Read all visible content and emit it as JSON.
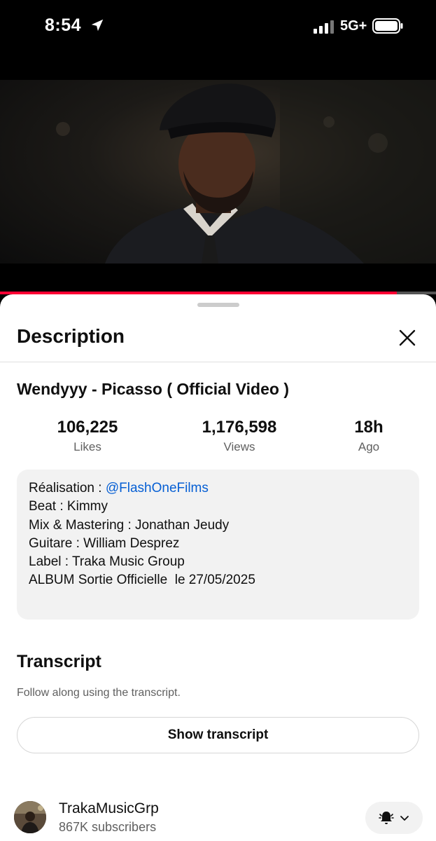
{
  "status_bar": {
    "time": "8:54",
    "network": "5G+",
    "location_icon": "location-arrow-icon",
    "signal_icon": "signal-bars-icon",
    "battery_icon": "battery-icon"
  },
  "video": {
    "progress_fraction": 0.91,
    "accent": "#ff0033"
  },
  "panel": {
    "title": "Description",
    "close_icon": "close-icon"
  },
  "video_info": {
    "title": "Wendyyy - Picasso ( Official Video )",
    "stats": [
      {
        "value": "106,225",
        "label": "Likes"
      },
      {
        "value": "1,176,598",
        "label": "Views"
      },
      {
        "value": "18h",
        "label": "Ago"
      }
    ]
  },
  "description": {
    "lines": [
      {
        "prefix": "Réalisation : ",
        "link": "@FlashOneFilms"
      },
      {
        "text": "Beat : Kimmy"
      },
      {
        "text": "Mix & Mastering : Jonathan Jeudy"
      },
      {
        "text": "Guitare : William Desprez"
      },
      {
        "text": "Label : Traka Music Group"
      },
      {
        "text": ""
      },
      {
        "text": "ALBUM Sortie Officielle  le 27/05/2025"
      }
    ],
    "link_color": "#065fd4"
  },
  "transcript": {
    "title": "Transcript",
    "subtitle": "Follow along using the transcript.",
    "button_label": "Show transcript"
  },
  "channel": {
    "name": "TrakaMusicGrp",
    "subscribers": "867K subscribers",
    "bell_icon": "bell-icon",
    "dropdown_icon": "chevron-down-icon"
  }
}
